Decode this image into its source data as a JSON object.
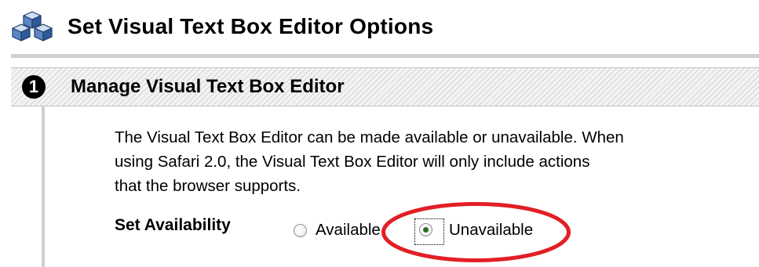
{
  "header": {
    "title": "Set Visual Text Box Editor Options",
    "icon": "cubes-icon"
  },
  "step": {
    "number": "1",
    "title": "Manage Visual Text Box Editor"
  },
  "description": {
    "line1": "The Visual Text Box Editor can be made available or unavailable. When",
    "line2": "using Safari 2.0, the Visual Text Box Editor will only include actions",
    "line3": "that the browser supports."
  },
  "availability": {
    "label": "Set Availability",
    "options": [
      {
        "label": "Available",
        "checked": false
      },
      {
        "label": "Unavailable",
        "checked": true
      }
    ],
    "selected": "Unavailable"
  },
  "colors": {
    "annotation": "#e21f26",
    "rule": "#cfcfcf",
    "radio_dot": "#2a6e1e"
  }
}
